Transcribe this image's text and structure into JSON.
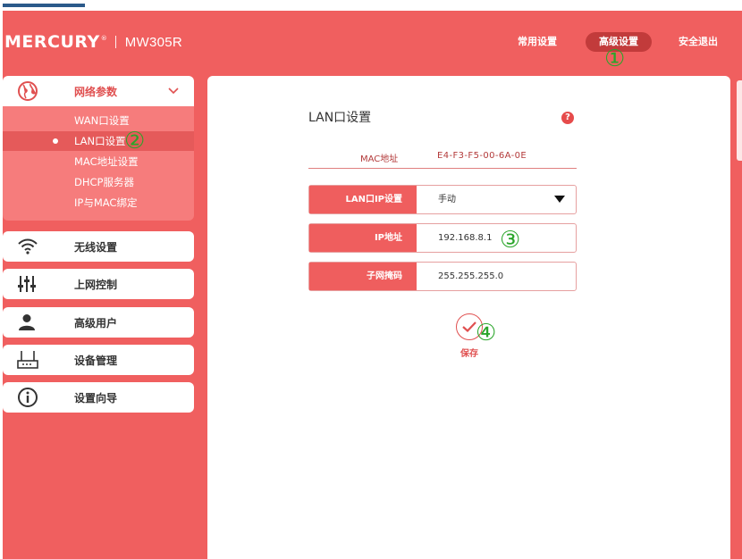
{
  "header": {
    "brand": "MERCURY",
    "registered": "®",
    "model": "MW305R",
    "nav": [
      {
        "label": "常用设置"
      },
      {
        "label": "高级设置"
      },
      {
        "label": "安全退出"
      }
    ]
  },
  "markers": [
    "①",
    "②",
    "③",
    "④"
  ],
  "sidebar": {
    "items": [
      {
        "label": "网络参数",
        "icon": "globe-icon"
      },
      {
        "label": "无线设置",
        "icon": "wifi-icon"
      },
      {
        "label": "上网控制",
        "icon": "sliders-icon"
      },
      {
        "label": "高级用户",
        "icon": "user-icon"
      },
      {
        "label": "设备管理",
        "icon": "router-icon"
      },
      {
        "label": "设置向导",
        "icon": "info-icon"
      }
    ],
    "subitems": [
      {
        "label": "WAN口设置"
      },
      {
        "label": "LAN口设置"
      },
      {
        "label": "MAC地址设置"
      },
      {
        "label": "DHCP服务器"
      },
      {
        "label": "IP与MAC绑定"
      }
    ]
  },
  "content": {
    "title": "LAN口设置",
    "help": "?",
    "mac": {
      "label": "MAC地址",
      "value": "E4-F3-F5-00-6A-0E"
    },
    "fields": [
      {
        "label": "LAN口IP设置",
        "value": "手动"
      },
      {
        "label": "IP地址",
        "value": "192.168.8.1"
      },
      {
        "label": "子网掩码",
        "value": "255.255.255.0"
      }
    ],
    "save_label": "保存"
  },
  "colors": {
    "accent": "#f05f5f",
    "accent_dark": "#c23b3b",
    "submenu": "#f67c7c",
    "marker": "#2aa52a"
  }
}
